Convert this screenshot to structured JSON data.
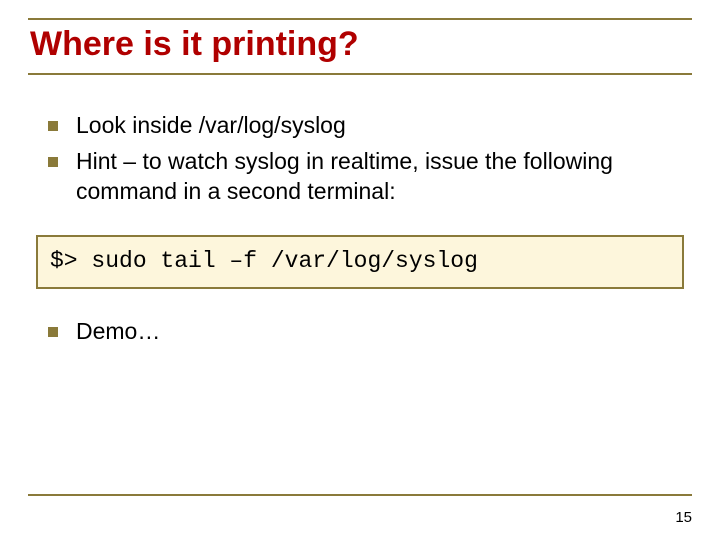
{
  "title": "Where is it printing?",
  "bullets_top": [
    "Look inside /var/log/syslog",
    "Hint – to watch syslog in realtime, issue the following command in a second terminal:"
  ],
  "code": "$> sudo tail –f /var/log/syslog",
  "bullets_bottom": [
    "Demo…"
  ],
  "page_number": "15",
  "colors": {
    "accent": "#8a7a3a",
    "title": "#b00000",
    "code_bg": "#fdf6dc"
  }
}
